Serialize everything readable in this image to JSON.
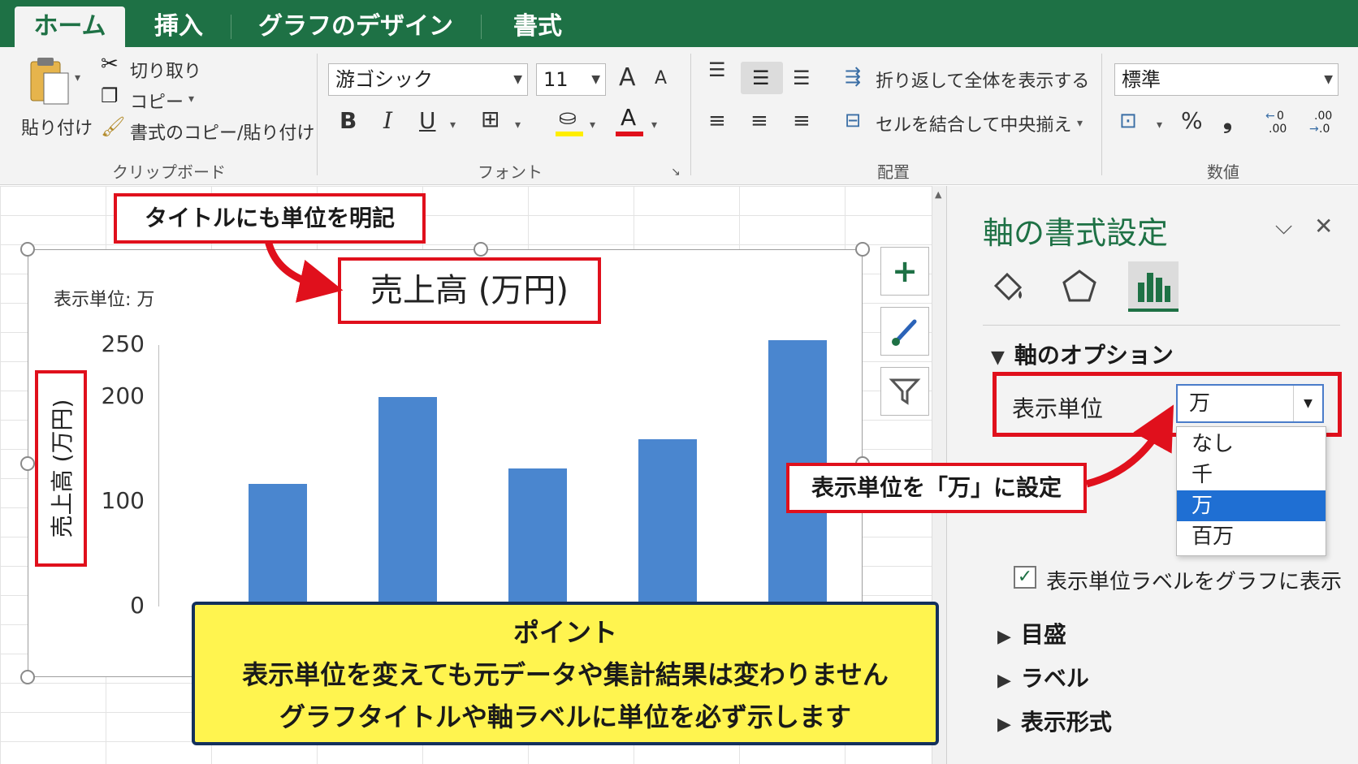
{
  "ribbon": {
    "tabs": [
      "ホーム",
      "挿入",
      "グラフのデザイン",
      "書式"
    ],
    "clipboard": {
      "paste": "貼り付け",
      "cut": "切り取り",
      "copy": "コピー",
      "format_painter": "書式のコピー/貼り付け",
      "group_label": "クリップボード"
    },
    "font": {
      "family": "游ゴシック",
      "size": "11",
      "bold": "B",
      "italic": "I",
      "underline": "U",
      "grow": "A",
      "shrink": "A",
      "font_color": "A",
      "group_label": "フォント"
    },
    "alignment": {
      "wrap_text": "折り返して全体を表示する",
      "merge_center": "セルを結合して中央揃え",
      "group_label": "配置"
    },
    "number": {
      "format": "標準",
      "percent": "%",
      "comma": "❟",
      "inc_decimal": ".00",
      "dec_decimal": ".0",
      "group_label": "数値"
    }
  },
  "chart": {
    "display_unit_label": "表示単位: 万",
    "title": "売上高 (万円)",
    "y_axis_title": "売上高 (万円)"
  },
  "chart_data": {
    "type": "bar",
    "title": "売上高 (万円)",
    "ylabel": "売上高 (万円)",
    "xlabel": "",
    "categories": [
      "",
      "",
      "",
      "",
      ""
    ],
    "values": [
      117,
      200,
      132,
      160,
      255
    ],
    "yticks": [
      0,
      100,
      200,
      250
    ],
    "ylim": [
      0,
      250
    ],
    "grid": false,
    "legend": "none",
    "bar_color": "#4a86cf"
  },
  "callouts": {
    "title_note": "タイトルにも単位を明記",
    "unit_note": "表示単位を「万」に設定",
    "point_heading": "ポイント",
    "point_line1": "表示単位を変えても元データや集計結果は変わりません",
    "point_line2": "グラフタイトルや軸ラベルに単位を必ず示します"
  },
  "pane": {
    "title": "軸の書式設定",
    "section_axis_options": "軸のオプション",
    "display_unit_label": "表示単位",
    "display_unit_value": "万",
    "dropdown_options": [
      "なし",
      "千",
      "万",
      "百万"
    ],
    "selected_option_index": 2,
    "show_unit_label_checkbox": "表示単位ラベルをグラフに表示",
    "show_unit_label_checked": true,
    "section_ticks": "目盛",
    "section_labels": "ラベル",
    "section_number_format": "表示形式"
  },
  "colors": {
    "excel_green": "#1e7145",
    "callout_red": "#e0101c",
    "bar_blue": "#4a86cf",
    "point_yellow": "#fff44f",
    "selected_blue": "#1f6fd3"
  }
}
